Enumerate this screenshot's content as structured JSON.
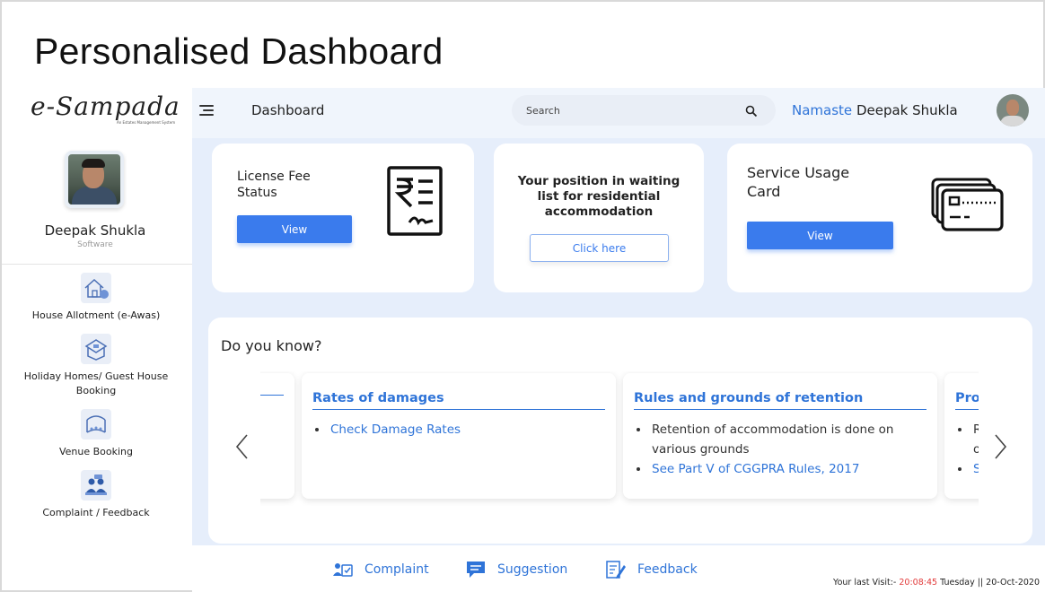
{
  "slide": {
    "title": "Personalised Dashboard"
  },
  "brand": {
    "logo": "e-Sampada",
    "tagline": "An Estates Management System"
  },
  "user": {
    "name": "Deepak Shukla",
    "role": "Software"
  },
  "sidebar": {
    "items": [
      {
        "label": "House Allotment (e-Awas)",
        "icon": "house-icon"
      },
      {
        "label": "Holiday Homes/ Guest House Booking",
        "icon": "holiday-home-icon"
      },
      {
        "label": "Venue Booking",
        "icon": "venue-icon"
      },
      {
        "label": "Complaint / Feedback",
        "icon": "complaint-feedback-icon"
      }
    ]
  },
  "header": {
    "title": "Dashboard",
    "search_placeholder": "Search",
    "greeting_prefix": "Namaste",
    "greeting_name": "Deepak Shukla"
  },
  "cards": {
    "license": {
      "title": "License Fee Status",
      "button": "View",
      "icon": "license-fee-receipt-icon"
    },
    "waiting": {
      "title": "Your position in waiting list for residential accommodation",
      "button": "Click here"
    },
    "service": {
      "title": "Service Usage Card",
      "button": "View",
      "icon": "service-cards-icon"
    }
  },
  "know": {
    "title": "Do you know?",
    "cards": [
      {
        "heading": "",
        "items": []
      },
      {
        "heading": "Rates of damages",
        "items": [
          {
            "text": "Check Damage Rates",
            "link": true
          }
        ]
      },
      {
        "heading": "Rules and grounds of retention",
        "items": [
          {
            "text": "Retention of accommodation is done on various grounds",
            "link": false
          },
          {
            "text": "See Part V of CGGPRA Rules, 2017",
            "link": true
          }
        ]
      },
      {
        "heading": "Pro",
        "items": [
          {
            "text": "R",
            "link": false
          },
          {
            "text": "o",
            "link": false
          },
          {
            "text": "S",
            "link": true
          }
        ]
      }
    ]
  },
  "footer": {
    "links": [
      {
        "label": "Complaint",
        "icon": "complaint-icon"
      },
      {
        "label": "Suggestion",
        "icon": "suggestion-icon"
      },
      {
        "label": "Feedback",
        "icon": "feedback-icon"
      }
    ],
    "last_visit_label": "Your last Visit:-",
    "last_visit_time": "20:08:45",
    "last_visit_date": "Tuesday || 20-Oct-2020"
  },
  "colors": {
    "accent": "#2f74d8",
    "button": "#3a7bed",
    "panel_bg": "#e6eefb",
    "topbar_bg": "#f0f5fc",
    "time_red": "#e23a3a"
  }
}
